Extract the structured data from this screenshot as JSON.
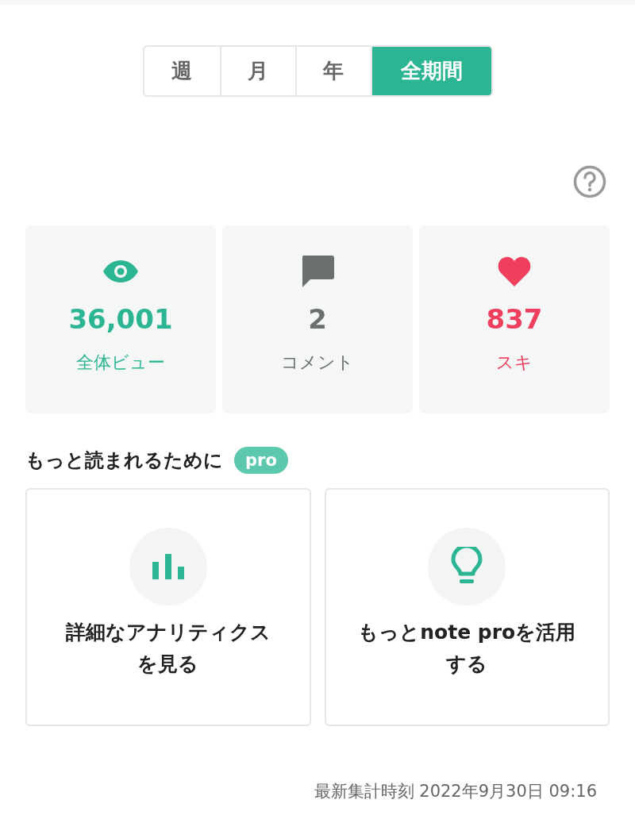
{
  "tabs": [
    {
      "label": "週",
      "selected": false
    },
    {
      "label": "月",
      "selected": false
    },
    {
      "label": "年",
      "selected": false
    },
    {
      "label": "全期間",
      "selected": true
    }
  ],
  "stats": [
    {
      "kind": "views",
      "value": "36,001",
      "label": "全体ビュー",
      "color": "#2bb592"
    },
    {
      "kind": "comments",
      "value": "2",
      "label": "コメント",
      "color": "#6b6f70"
    },
    {
      "kind": "likes",
      "value": "837",
      "label": "スキ",
      "color": "#ee3f5f"
    }
  ],
  "promo": {
    "title": "もっと読まれるために",
    "badge": "pro",
    "cards": [
      {
        "kind": "analytics",
        "lines": [
          "詳細なアナリティクス",
          "を見る"
        ]
      },
      {
        "kind": "tips",
        "lines": [
          "もっとnote proを活用",
          "する"
        ]
      }
    ]
  },
  "footer": "最新集計時刻 2022年9月30日 09:16"
}
